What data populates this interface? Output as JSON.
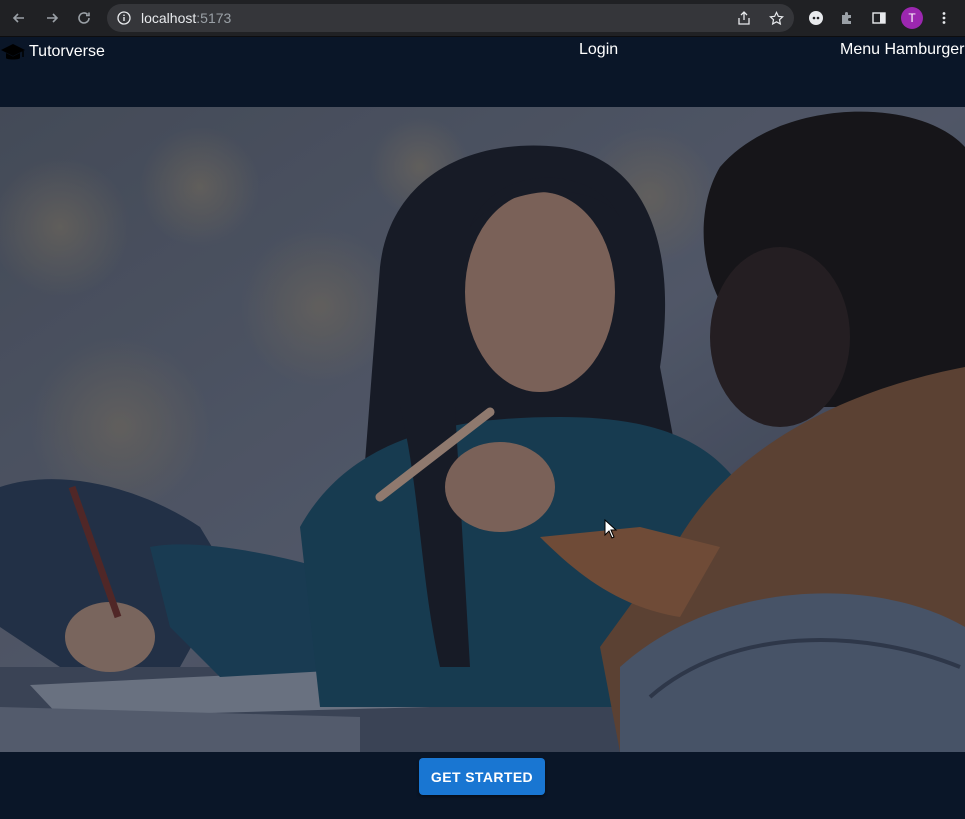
{
  "browser": {
    "url_host": "localhost",
    "url_port": ":5173",
    "profile_initial": "T"
  },
  "header": {
    "brand": "Tutorverse",
    "login": "Login",
    "menu": "Menu Hamburger"
  },
  "hero": {
    "image": "students-studying-photo"
  },
  "cta": {
    "label": "GET STARTED",
    "color": "#1976d2"
  },
  "colors": {
    "page_background": "#0a1628",
    "chrome_background": "#202124"
  }
}
